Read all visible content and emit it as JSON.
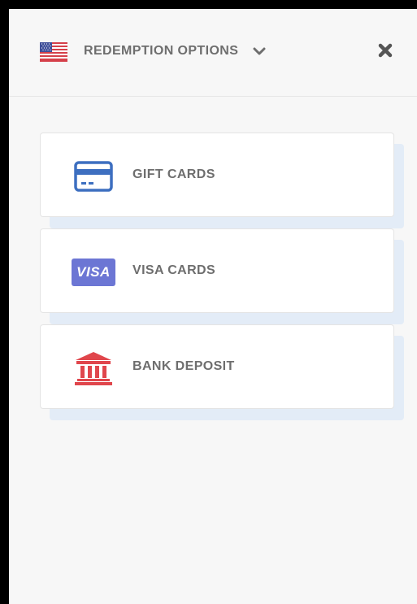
{
  "header": {
    "title": "REDEMPTION OPTIONS",
    "flag_icon": "us-flag-icon",
    "dropdown_icon": "chevron-down-icon",
    "close_icon": "close-icon"
  },
  "options": [
    {
      "label": "GIFT CARDS",
      "icon": "credit-card-icon",
      "icon_color": "#3d6fc0"
    },
    {
      "label": "VISA CARDS",
      "icon": "visa-icon",
      "icon_text": "VISA",
      "icon_color": "#6c76d4"
    },
    {
      "label": "BANK DEPOSIT",
      "icon": "bank-icon",
      "icon_color": "#e0464c"
    }
  ],
  "colors": {
    "panel_background": "#f7f7f7",
    "card_background": "#ffffff",
    "card_shadow": "#e3ecf7",
    "text": "#6e6e6e",
    "close_icon": "#555555"
  }
}
